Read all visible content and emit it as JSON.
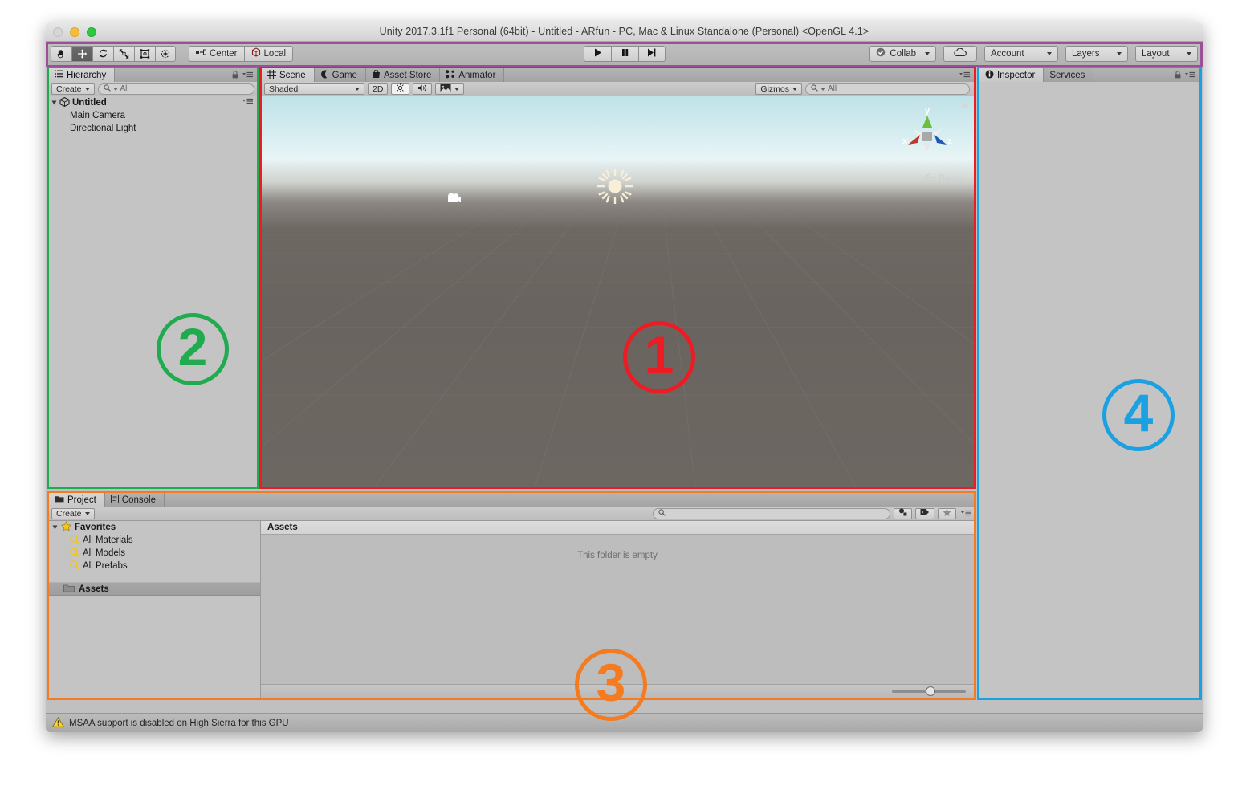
{
  "window": {
    "title": "Unity 2017.3.1f1 Personal (64bit) - Untitled - ARfun - PC, Mac & Linux Standalone (Personal) <OpenGL 4.1>",
    "traffic_lights": [
      "close",
      "minimize",
      "maximize"
    ]
  },
  "toolbar": {
    "tools": [
      {
        "name": "hand-tool",
        "icon": "hand-icon",
        "active": false
      },
      {
        "name": "move-tool",
        "icon": "move-icon",
        "active": true
      },
      {
        "name": "rotate-tool",
        "icon": "rotate-icon",
        "active": false
      },
      {
        "name": "scale-tool",
        "icon": "scale-icon",
        "active": false
      },
      {
        "name": "rect-tool",
        "icon": "rect-icon",
        "active": false
      },
      {
        "name": "transform-tool",
        "icon": "transform-icon",
        "active": false
      }
    ],
    "pivot_label": "Center",
    "pivot_icon": "pivot-center-icon",
    "space_label": "Local",
    "space_icon": "cube-local-icon",
    "play_controls": [
      {
        "name": "play-button",
        "icon": "play-icon"
      },
      {
        "name": "pause-button",
        "icon": "pause-icon"
      },
      {
        "name": "step-button",
        "icon": "step-icon"
      }
    ],
    "collab_label": "Collab",
    "collab_icon": "collab-check-icon",
    "cloud_icon": "cloud-icon",
    "account_label": "Account",
    "layers_label": "Layers",
    "layout_label": "Layout"
  },
  "hierarchy": {
    "tab_label": "Hierarchy",
    "tab_icon": "hierarchy-icon",
    "create_label": "Create",
    "search_placeholder": "All",
    "search_icon": "search-icon",
    "scene_name": "Untitled",
    "scene_icon": "unity-scene-icon",
    "objects": [
      {
        "label": "Main Camera"
      },
      {
        "label": "Directional Light"
      }
    ]
  },
  "scene": {
    "tabs": [
      {
        "label": "Scene",
        "icon": "scene-grid-icon",
        "selected": true
      },
      {
        "label": "Game",
        "icon": "game-pad-icon",
        "selected": false
      },
      {
        "label": "Asset Store",
        "icon": "asset-store-icon",
        "selected": false
      },
      {
        "label": "Animator",
        "icon": "animator-icon",
        "selected": false
      }
    ],
    "draw_mode": "Shaded",
    "twod_label": "2D",
    "lighting_icon": "lighting-icon",
    "audio_icon": "audio-icon",
    "fx_icon": "image-fx-icon",
    "gizmos_label": "Gizmos",
    "search_placeholder": "All",
    "gizmo_axes": {
      "x": "x",
      "y": "y",
      "z": "z"
    },
    "projection_label": "Persp",
    "scene_objects": [
      {
        "name": "main-camera-gizmo",
        "icon": "camera-icon"
      },
      {
        "name": "directional-light-gizmo",
        "icon": "sun-icon"
      }
    ]
  },
  "project": {
    "tabs": [
      {
        "label": "Project",
        "icon": "project-folder-icon",
        "selected": true
      },
      {
        "label": "Console",
        "icon": "console-icon",
        "selected": false
      }
    ],
    "create_label": "Create",
    "search_placeholder": "",
    "search_icon": "search-icon",
    "filter_icons": [
      "filter-type-icon",
      "filter-label-icon",
      "filter-favorite-icon"
    ],
    "favorites_label": "Favorites",
    "favorites_icon": "star-icon",
    "favorites": [
      {
        "label": "All Materials",
        "icon": "search-icon"
      },
      {
        "label": "All Models",
        "icon": "search-icon"
      },
      {
        "label": "All Prefabs",
        "icon": "search-icon"
      }
    ],
    "assets_root_label": "Assets",
    "assets_root_icon": "folder-icon",
    "breadcrumb": "Assets",
    "empty_message": "This folder is empty",
    "zoom_value": 45
  },
  "inspector": {
    "tabs": [
      {
        "label": "Inspector",
        "icon": "info-icon",
        "selected": true
      },
      {
        "label": "Services",
        "icon": "",
        "selected": false
      }
    ]
  },
  "statusbar": {
    "warning_icon": "warning-icon",
    "message": "MSAA support is disabled on High Sierra for this GPU"
  },
  "annotations": [
    {
      "id": "1",
      "label": "1",
      "color": "#ec1c24",
      "target": "scene-view"
    },
    {
      "id": "2",
      "label": "2",
      "color": "#1fab4e",
      "target": "hierarchy-panel"
    },
    {
      "id": "3",
      "label": "3",
      "color": "#f47b20",
      "target": "project-panel"
    },
    {
      "id": "4",
      "label": "4",
      "color": "#1ba1e2",
      "target": "inspector-panel"
    }
  ],
  "colors": {
    "annotation_red": "#ec1c24",
    "annotation_green": "#1fab4e",
    "annotation_orange": "#f47b20",
    "annotation_blue": "#1ba1e2",
    "annotation_purple": "#9b4f96"
  }
}
